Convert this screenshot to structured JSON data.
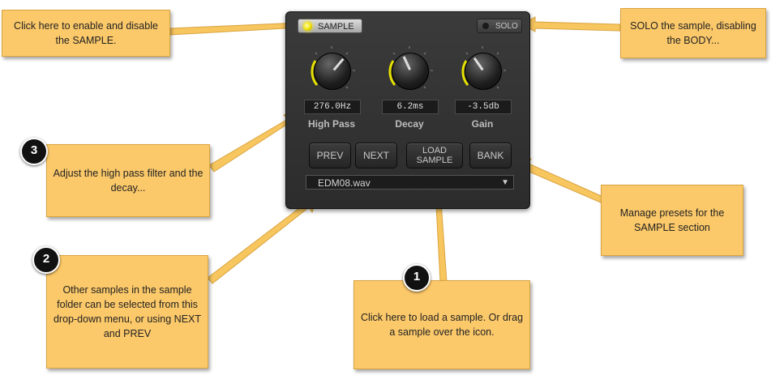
{
  "panel": {
    "sample_toggle": "SAMPLE",
    "solo_toggle": "SOLO",
    "knobs": [
      {
        "readout": "276.0Hz",
        "label": "High Pass"
      },
      {
        "readout": "6.2ms",
        "label": "Decay"
      },
      {
        "readout": "-3.5db",
        "label": "Gain"
      }
    ],
    "buttons": {
      "prev": "PREV",
      "next": "NEXT",
      "load_line1": "LOAD",
      "load_line2": "SAMPLE",
      "bank": "BANK"
    },
    "dropdown": {
      "value": "EDM08.wav"
    }
  },
  "callouts": {
    "enable": "Click here to enable and disable the SAMPLE.",
    "solo": "SOLO the sample, disabling the BODY...",
    "adjust": "Adjust the high pass filter and the decay...",
    "presets": "Manage presets for the SAMPLE section",
    "samples": "Other samples in the sample folder can be selected from this drop-down menu, or using NEXT and PREV",
    "load": "Click here to load a sample.  Or drag a sample over the icon."
  },
  "badges": {
    "one": "1",
    "two": "2",
    "three": "3"
  },
  "colors": {
    "callout": "#fcc96a",
    "arrow": "#f7c65f",
    "led": "#f0e000"
  }
}
